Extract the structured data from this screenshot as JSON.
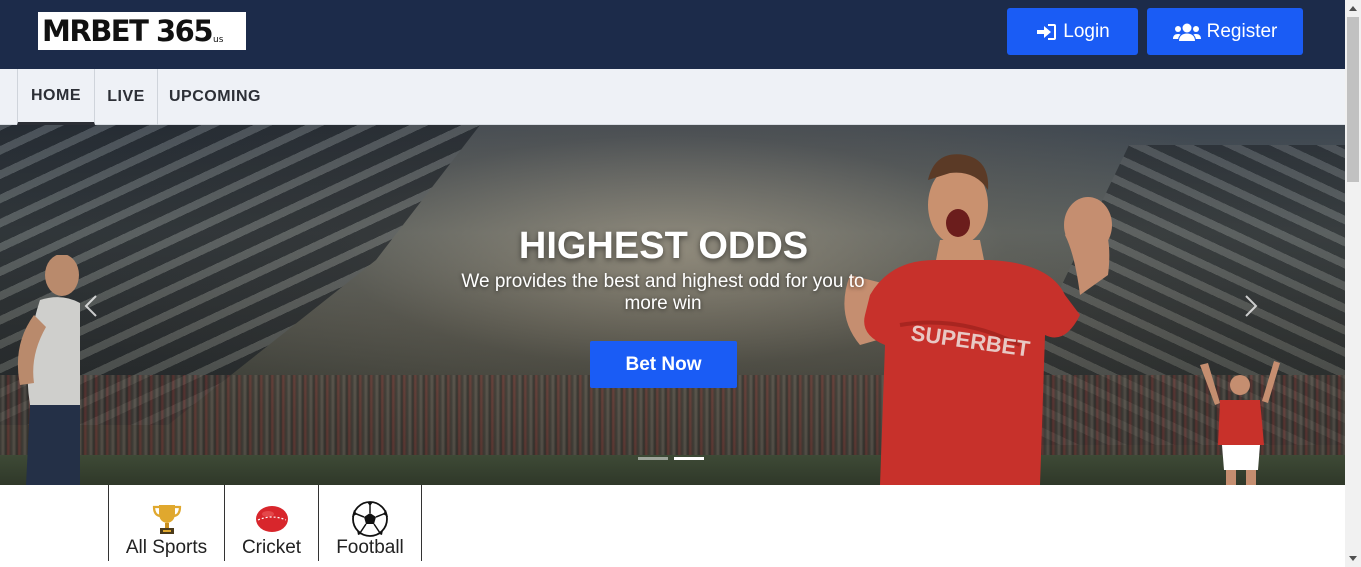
{
  "header": {
    "logo": {
      "main": "MRBET 365",
      "suffix": "us"
    },
    "login_label": "Login",
    "register_label": "Register",
    "accent_color": "#1a5cf5",
    "background_color": "#1c2b4a"
  },
  "nav": {
    "items": [
      {
        "label": "HOME",
        "active": true
      },
      {
        "label": "LIVE",
        "active": false
      },
      {
        "label": "UPCOMING",
        "active": false
      }
    ]
  },
  "hero": {
    "title": "HIGHEST ODDS",
    "subtitle": "We provides the best and highest odd for you to more win",
    "cta_label": "Bet Now",
    "jersey_text": "SUPERBET",
    "slide_count": 2,
    "active_slide": 2
  },
  "sports": {
    "tabs": [
      {
        "label": "All Sports",
        "icon": "trophy-icon"
      },
      {
        "label": "Cricket",
        "icon": "cricket-ball-icon"
      },
      {
        "label": "Football",
        "icon": "football-icon"
      }
    ]
  }
}
